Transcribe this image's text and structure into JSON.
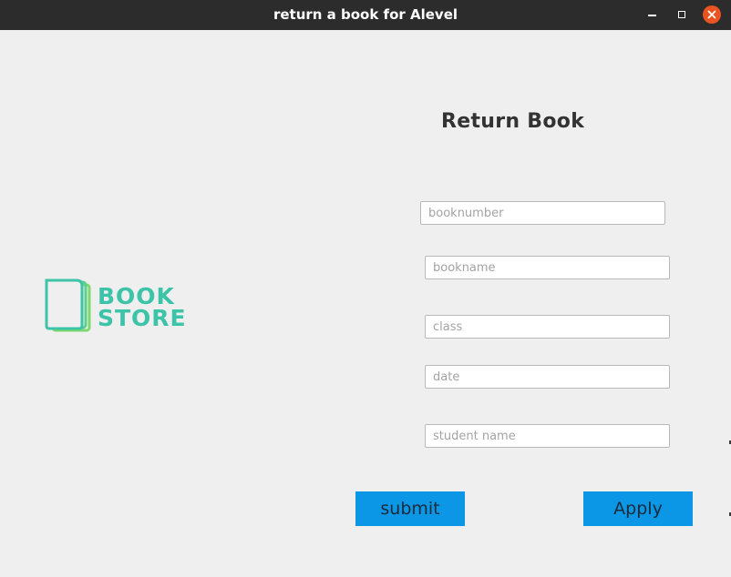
{
  "window": {
    "title": "return a book for Alevel",
    "controls": [
      "minimize-icon",
      "maximize-icon",
      "close-icon"
    ],
    "close_color": "#e95420"
  },
  "logo": {
    "line1": "BOOK",
    "line2": "STORE",
    "color": "#3dc4a8",
    "accent_color": "#7bd96e"
  },
  "form": {
    "heading": "Return Book",
    "fields": {
      "booknumber": {
        "value": "",
        "placeholder": "booknumber"
      },
      "bookname": {
        "value": "",
        "placeholder": "bookname"
      },
      "class": {
        "value": "",
        "placeholder": "class"
      },
      "date": {
        "value": "",
        "placeholder": "date"
      },
      "student_name": {
        "value": "",
        "placeholder": "student name"
      }
    },
    "submit_label": "submit",
    "apply_label": "Apply",
    "button_color": "#0b96e6"
  }
}
